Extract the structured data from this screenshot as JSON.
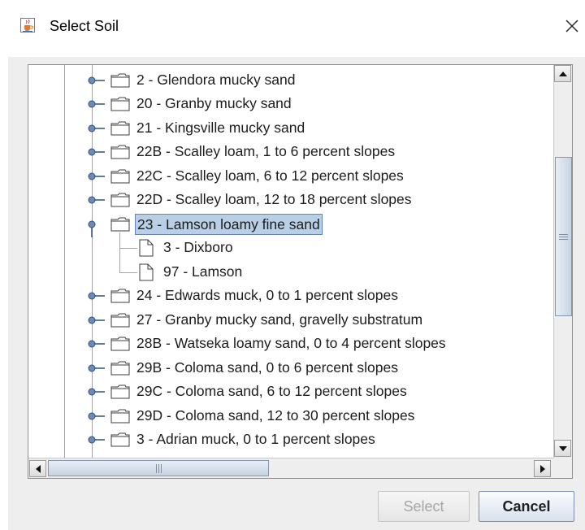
{
  "window": {
    "title": "Select Soil",
    "app_icon": "java-cup-icon",
    "close_icon": "close-x-icon"
  },
  "tree": {
    "nodes": [
      {
        "label": "2 - Glendora mucky sand",
        "type": "folder",
        "expanded": false
      },
      {
        "label": "20 - Granby mucky sand",
        "type": "folder",
        "expanded": false
      },
      {
        "label": "21 - Kingsville mucky sand",
        "type": "folder",
        "expanded": false
      },
      {
        "label": "22B - Scalley loam, 1 to 6 percent slopes",
        "type": "folder",
        "expanded": false
      },
      {
        "label": "22C - Scalley loam, 6 to 12 percent slopes",
        "type": "folder",
        "expanded": false
      },
      {
        "label": "22D - Scalley loam, 12 to 18 percent slopes",
        "type": "folder",
        "expanded": false
      },
      {
        "label": "23 - Lamson loamy fine sand",
        "type": "folder",
        "expanded": true,
        "selected": true
      },
      {
        "label": "3 - Dixboro",
        "type": "leaf",
        "parent": "23 - Lamson loamy fine sand"
      },
      {
        "label": "97 - Lamson",
        "type": "leaf",
        "parent": "23 - Lamson loamy fine sand"
      },
      {
        "label": "24 - Edwards muck, 0 to 1 percent slopes",
        "type": "folder",
        "expanded": false
      },
      {
        "label": "27 - Granby mucky sand, gravelly substratum",
        "type": "folder",
        "expanded": false
      },
      {
        "label": "28B - Watseka loamy sand, 0 to 4 percent slopes",
        "type": "folder",
        "expanded": false
      },
      {
        "label": "29B - Coloma sand, 0 to 6 percent slopes",
        "type": "folder",
        "expanded": false
      },
      {
        "label": "29C - Coloma sand, 6 to 12 percent slopes",
        "type": "folder",
        "expanded": false
      },
      {
        "label": "29D - Coloma sand, 12 to 30 percent slopes",
        "type": "folder",
        "expanded": false
      },
      {
        "label": "3 - Adrian muck, 0 to 1 percent slopes",
        "type": "folder",
        "expanded": false
      }
    ]
  },
  "scrollbars": {
    "vertical_position": 0.33,
    "horizontal_position": 0.0
  },
  "buttons": {
    "select_label": "Select",
    "select_enabled": false,
    "cancel_label": "Cancel"
  },
  "colors": {
    "selection_bg": "#b8cfe5",
    "selection_border": "#6382bf",
    "dialog_bg": "#eeeeee"
  }
}
